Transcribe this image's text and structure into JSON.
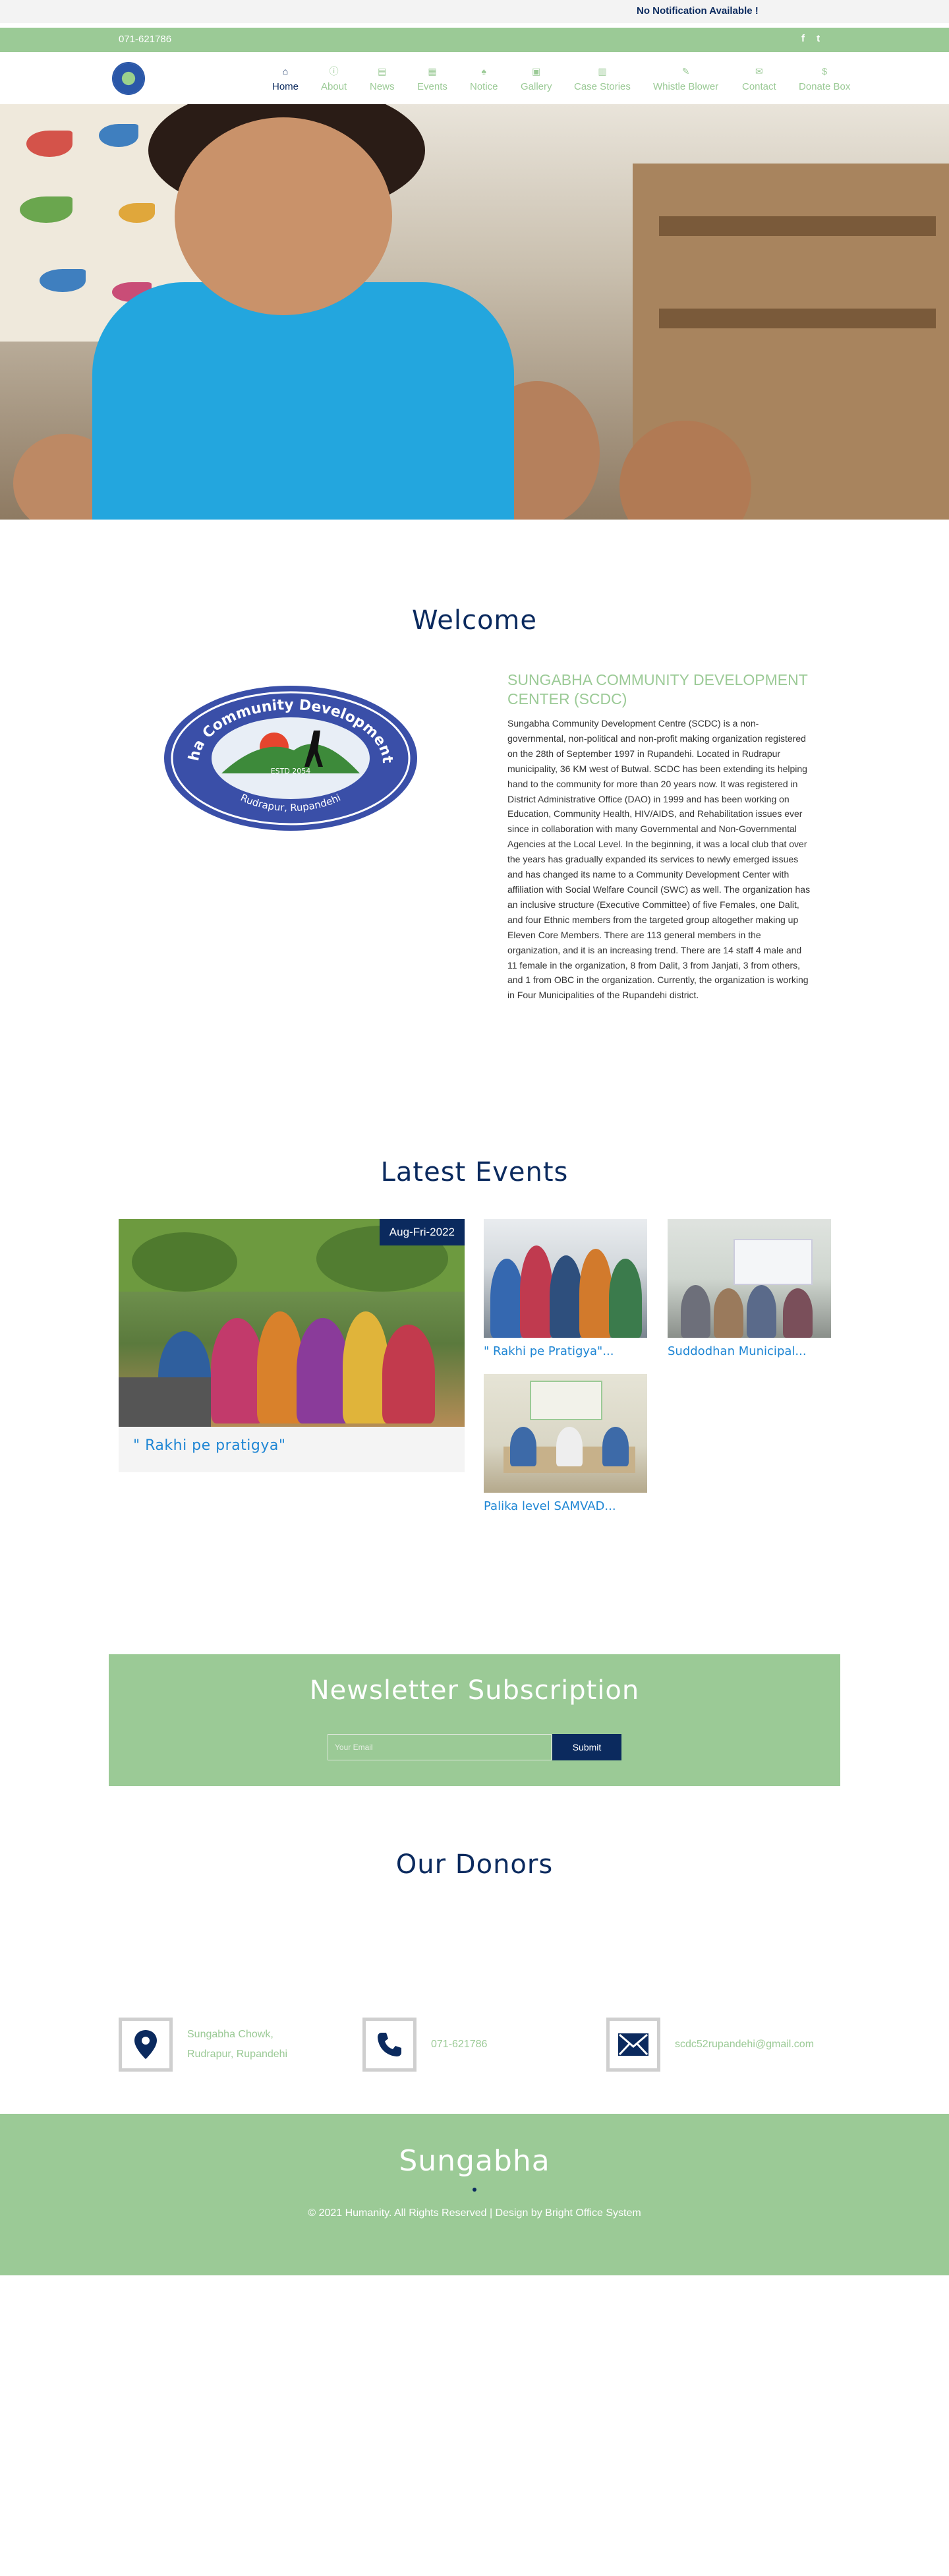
{
  "topbar": {
    "notification": "No Notification Available !"
  },
  "contactbar": {
    "phone": "071-621786",
    "facebook_glyph": "f",
    "twitter_glyph": "t"
  },
  "nav": {
    "items": [
      {
        "label": "Home",
        "icon": "home-icon",
        "glyph": "⌂"
      },
      {
        "label": "About",
        "icon": "info-icon",
        "glyph": "ⓘ"
      },
      {
        "label": "News",
        "icon": "newspaper-icon",
        "glyph": "▤"
      },
      {
        "label": "Events",
        "icon": "calendar-icon",
        "glyph": "▦"
      },
      {
        "label": "Notice",
        "icon": "bell-icon",
        "glyph": "♠"
      },
      {
        "label": "Gallery",
        "icon": "image-icon",
        "glyph": "▣"
      },
      {
        "label": "Case Stories",
        "icon": "book-icon",
        "glyph": "▥"
      },
      {
        "label": "Whistle Blower",
        "icon": "pencil-icon",
        "glyph": "✎"
      },
      {
        "label": "Contact",
        "icon": "envelope-icon",
        "glyph": "✉"
      },
      {
        "label": "Donate Box",
        "icon": "dollar-icon",
        "glyph": "$"
      }
    ]
  },
  "welcome": {
    "heading": "Welcome",
    "logo_text_top": "Sungabha Community Development Centre",
    "logo_text_bottom": "Rudrapur, Rupandehi",
    "logo_est": "ESTD 2054",
    "title": "SUNGABHA COMMUNITY DEVELOPMENT CENTER (SCDC)",
    "body": "Sungabha Community Development Centre (SCDC) is a non-governmental, non-political and non-profit making organization registered on the 28th of September 1997 in Rupandehi. Located in Rudrapur municipality, 36 KM west of Butwal. SCDC has been extending its helping hand to the community for more than 20 years now. It was registered in District Administrative Office (DAO) in 1999 and has been working on Education, Community Health, HIV/AIDS, and Rehabilitation issues ever since in collaboration with many Governmental and Non-Governmental Agencies at the Local Level. In the beginning, it was a local club that over the years has gradually expanded its services to newly emerged issues and has changed its name to a Community Development Center with affiliation with Social Welfare Council (SWC) as well. The organization has an inclusive structure (Executive Committee) of five Females, one Dalit, and four Ethnic members from the targeted group altogether making up Eleven Core Members. There are 113 general members in the organization, and it is an increasing trend. There are 14 staff 4 male and 11 female in the organization, 8 from Dalit, 3 from Janjati, 3 from others, and 1 from OBC in the organization. Currently, the organization is working in Four Municipalities of the Rupandehi district."
  },
  "events": {
    "heading": "Latest Events",
    "featured": {
      "date": "Aug-Fri-2022",
      "title": "\" Rakhi pe pratigya\""
    },
    "items": [
      {
        "title": "\" Rakhi pe Pratigya\"..."
      },
      {
        "title": "Suddodhan Municipal..."
      },
      {
        "title": "Palika level SAMVAD..."
      }
    ]
  },
  "newsletter": {
    "heading": "Newsletter Subscription",
    "placeholder": "Your Email",
    "submit": "Submit"
  },
  "donors": {
    "heading": "Our Donors"
  },
  "contact": {
    "address_line1": "Sungabha Chowk,",
    "address_line2": "Rudrapur, Rupandehi",
    "phone": "071-621786",
    "email": "scdc52rupandehi@gmail.com"
  },
  "footer": {
    "brand": "Sungabha",
    "copyright": "© 2021 Humanity. All Rights Reserved | Design by Bright Office System"
  },
  "colors": {
    "green": "#9bca96",
    "navy": "#0b2a5e",
    "link_blue": "#1f86d4"
  }
}
